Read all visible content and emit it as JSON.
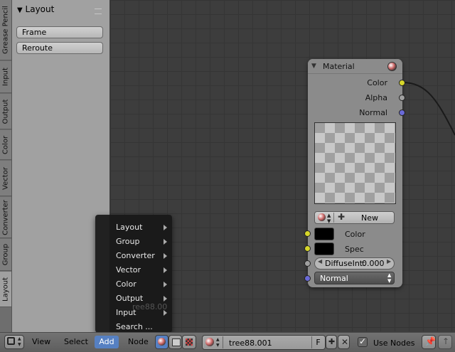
{
  "tabs": [
    "Grease Pencil",
    "Input",
    "Output",
    "Color",
    "Vector",
    "Converter",
    "Group",
    "Layout"
  ],
  "panel": {
    "title": "Layout",
    "buttons": [
      "Frame",
      "Reroute"
    ]
  },
  "node": {
    "title": "Material",
    "outputs": [
      "Color",
      "Alpha",
      "Normal"
    ],
    "new_label": "New",
    "inputs": [
      "Color",
      "Spec"
    ],
    "diffuse_label": "DiffuseInt:",
    "diffuse_value": "0.000",
    "normal_label": "Normal"
  },
  "add_menu": {
    "items": [
      "Layout",
      "Group",
      "Converter",
      "Vector",
      "Color",
      "Output",
      "Input",
      "Search ..."
    ],
    "ghost_text": "ree88.00"
  },
  "header": {
    "menus": [
      "View",
      "Select",
      "Add",
      "Node"
    ],
    "tree_name": "tree88.001",
    "fake_user": "F",
    "use_nodes_label": "Use Nodes"
  },
  "colors": {
    "socket_color": "#d6d62a",
    "socket_gray": "#a0a0a0",
    "socket_vector": "#6a6ad8",
    "menu_highlight": "#5680c2"
  }
}
